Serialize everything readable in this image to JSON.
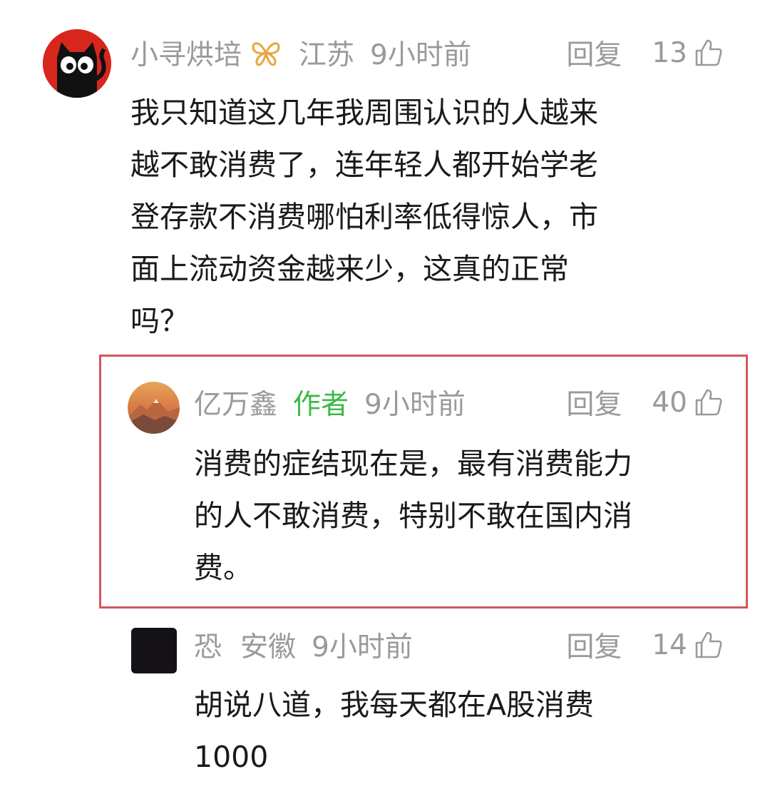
{
  "comments": [
    {
      "username": "小寻烘培",
      "badge_icon": "butterfly-badge-icon",
      "location": "江苏",
      "time": "9小时前",
      "reply_label": "回复",
      "likes": "13",
      "text_lines": [
        "我只知道这几年我周围认识的人越来",
        "越不敢消费了，连年轻人都开始学老",
        "登存款不消费哪怕利率低得惊人，市",
        "面上流动资金越来少，这真的正常",
        "吗？"
      ]
    },
    {
      "username": "亿万鑫",
      "author_tag": "作者",
      "time": "9小时前",
      "reply_label": "回复",
      "likes": "40",
      "text_lines": [
        "消费的症结现在是，最有消费能力",
        "的人不敢消费，特别不敢在国内消",
        "费。"
      ]
    },
    {
      "username": "恐",
      "location": "安徽",
      "time": "9小时前",
      "reply_label": "回复",
      "likes": "14",
      "text_lines": [
        "胡说八道，我每天都在A股消费",
        "1000"
      ]
    }
  ],
  "colors": {
    "meta_gray": "#9a9a9a",
    "author_green": "#3db848",
    "highlight_red": "#d4565e",
    "text": "#1a1a1a"
  }
}
